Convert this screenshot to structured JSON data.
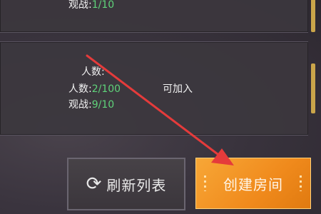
{
  "rooms": [
    {
      "spectators_label": "观战:",
      "spectators_value": "1/10"
    },
    {
      "header_label": "人数:",
      "players_label": "人数:",
      "players_value": "2/100",
      "status": "可加入",
      "spectators_label": "观战:",
      "spectators_value": "9/10"
    }
  ],
  "buttons": {
    "refresh_label": "刷新列表",
    "create_label": "创建房间",
    "refresh_icon": "refresh-icon"
  },
  "colors": {
    "accent_orange": "#f08a1c",
    "count_green": "#5fd37a",
    "arrow_red": "#e53b3b"
  }
}
